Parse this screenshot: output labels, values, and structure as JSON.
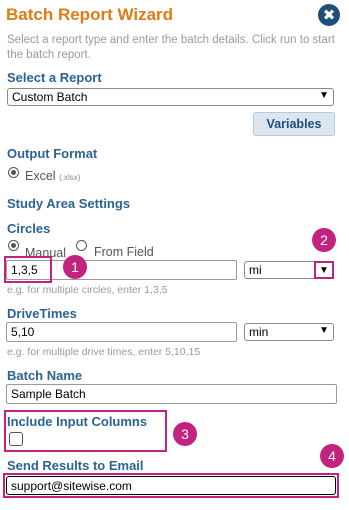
{
  "header": {
    "title": "Batch Report Wizard",
    "close_icon": "✖",
    "description": "Select a report type and enter the batch details. Click run to start the batch report."
  },
  "report": {
    "section": "Select a Report",
    "selected": "Custom Batch",
    "variables_button": "Variables"
  },
  "output": {
    "section": "Output Format",
    "option_label": "Excel",
    "option_ext": "(.xlsx)"
  },
  "study": {
    "section": "Study Area Settings",
    "circles_label": "Circles",
    "radio_manual": "Manual",
    "radio_field": "From Field",
    "circles_value": "1,3,5",
    "circles_unit": "mi",
    "circles_hint": "e.g. for multiple circles, enter 1,3,5",
    "drivetimes_label": "DriveTimes",
    "drivetimes_value": "5,10",
    "drivetimes_unit": "min",
    "drivetimes_hint": "e.g. for multiple drive times, enter 5,10,15"
  },
  "batch": {
    "name_label": "Batch Name",
    "name_value": "Sample Batch",
    "include_label": "Include Input Columns",
    "email_label": "Send Results to Email",
    "email_value": "support@sitewise.com"
  },
  "callouts": [
    "1",
    "2",
    "3",
    "4"
  ],
  "colors": {
    "title": "#e07b14",
    "section": "#2a6496",
    "highlight": "#c2237f",
    "close": "#1f4e79"
  }
}
